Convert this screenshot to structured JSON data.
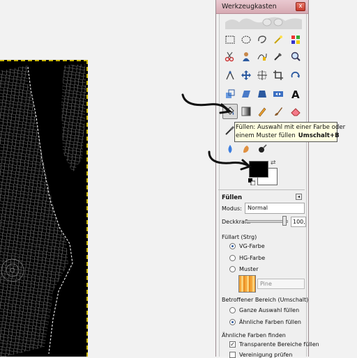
{
  "window": {
    "title": "Werkzeugkasten",
    "close_glyph": "x"
  },
  "tools": [
    {
      "name": "rect-select-icon"
    },
    {
      "name": "ellipse-select-icon"
    },
    {
      "name": "free-select-icon"
    },
    {
      "name": "fuzzy-select-icon"
    },
    {
      "name": "color-select-icon"
    },
    {
      "name": "scissors-select-icon"
    },
    {
      "name": "foreground-select-icon"
    },
    {
      "name": "paths-icon"
    },
    {
      "name": "color-picker-icon"
    },
    {
      "name": "zoom-icon"
    },
    {
      "name": "measure-icon"
    },
    {
      "name": "move-icon"
    },
    {
      "name": "align-icon"
    },
    {
      "name": "crop-icon"
    },
    {
      "name": "rotate-icon"
    },
    {
      "name": "scale-icon"
    },
    {
      "name": "shear-icon"
    },
    {
      "name": "perspective-icon"
    },
    {
      "name": "flip-icon"
    },
    {
      "name": "text-icon"
    },
    {
      "name": "bucket-fill-icon"
    },
    {
      "name": "blend-icon"
    },
    {
      "name": "pencil-icon"
    },
    {
      "name": "paintbrush-icon"
    },
    {
      "name": "eraser-icon"
    },
    {
      "name": "airbrush-icon"
    },
    {
      "name": "blur-icon"
    },
    {
      "name": "smudge-icon"
    },
    {
      "name": "dodge-burn-icon"
    }
  ],
  "tooltip": {
    "line1": "Füllen: Auswahl mit einer Farbe oder",
    "line2": "einem Muster füllen",
    "shortcut": "Umschalt+B"
  },
  "colors": {
    "foreground": "#000000",
    "background": "#ffffff",
    "swap_glyph": "⇄"
  },
  "tool_options": {
    "title": "Füllen",
    "mode_label": "Modus:",
    "mode_value": "Normal",
    "opacity_label": "Deckkraft:",
    "opacity_value": "100,0",
    "opacity_fraction": 1.0,
    "fill_type_label": "Füllart  (Strg)",
    "fill_types": [
      {
        "label": "VG-Farbe",
        "selected": true
      },
      {
        "label": "HG-Farbe",
        "selected": false
      },
      {
        "label": "Muster",
        "selected": false
      }
    ],
    "pattern_name": "Pine",
    "affected_area_label": "Betroffener Bereich (Umschalt)",
    "affected_areas": [
      {
        "label": "Ganze Auswahl füllen",
        "selected": false
      },
      {
        "label": "Ähnliche Farben füllen",
        "selected": true
      }
    ],
    "find_similar_label": "Ähnliche Farben finden",
    "checkboxes": [
      {
        "label": "Transparente Bereiche füllen",
        "checked": true
      },
      {
        "label": "Vereinigung prüfen",
        "checked": false
      }
    ]
  }
}
